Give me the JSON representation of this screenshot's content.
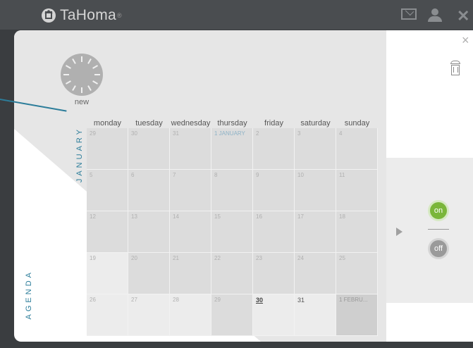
{
  "header": {
    "logo_text": "TaHoma",
    "logo_reg": "®"
  },
  "panel": {
    "close_label": "×",
    "new_label": "new",
    "january_label": "JANUARY",
    "agenda_label": "AGENDA",
    "on_label": "on",
    "off_label": "off"
  },
  "calendar": {
    "days": [
      "monday",
      "tuesday",
      "wednesday",
      "thursday",
      "friday",
      "saturday",
      "sunday"
    ],
    "weeks": [
      [
        "29",
        "30",
        "31",
        "1 JANUARY",
        "2",
        "3",
        "4"
      ],
      [
        "5",
        "6",
        "7",
        "8",
        "9",
        "10",
        "11"
      ],
      [
        "12",
        "13",
        "14",
        "15",
        "16",
        "17",
        "18"
      ],
      [
        "19",
        "20",
        "21",
        "22",
        "23",
        "24",
        "25"
      ],
      [
        "26",
        "27",
        "28",
        "29",
        "30",
        "31",
        "1 FEBRU..."
      ]
    ]
  }
}
